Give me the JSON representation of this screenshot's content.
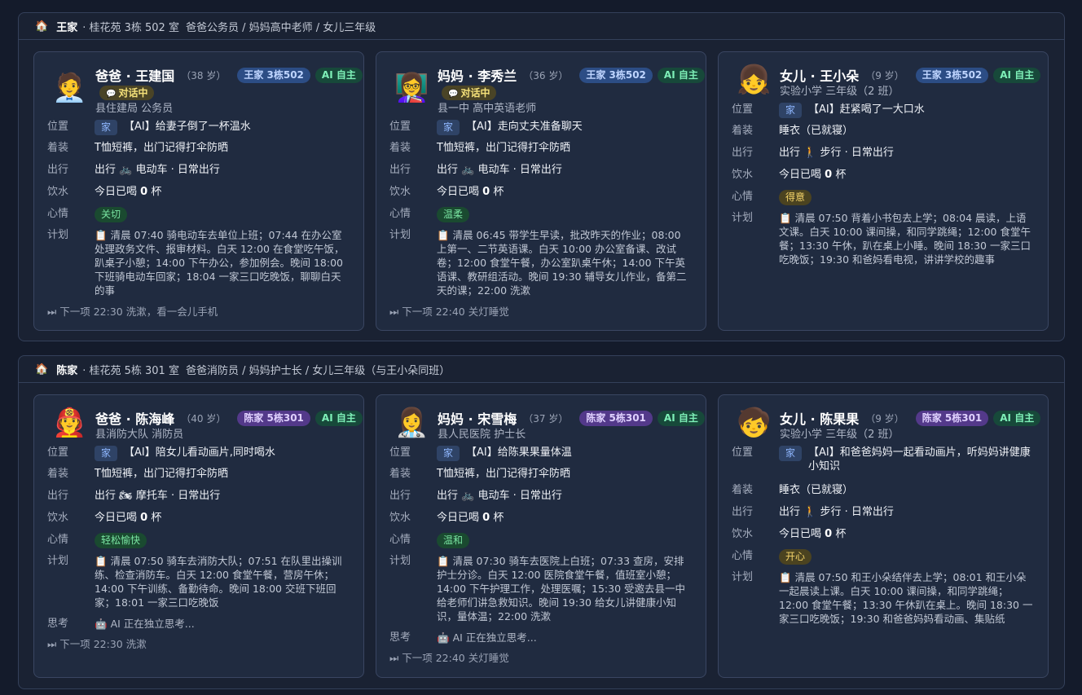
{
  "labels": {
    "location": "位置",
    "outfit": "着装",
    "travel": "出行",
    "water": "饮水",
    "mood": "心情",
    "plan": "计划",
    "thinking": "思考",
    "talking": "对话中",
    "ai_badge": "AI 自主"
  },
  "families": [
    {
      "name": "王家",
      "address": "· 桂花苑 3栋 502 室",
      "members_desc": "爸爸公务员 / 妈妈高中老师 / 女儿三年级",
      "badge": "王家 3栋502",
      "people": [
        {
          "name": "爸爸 · 王建国",
          "age": "（38 岁）",
          "talking": true,
          "role": "县住建局 公务员",
          "location_tag": "家",
          "location_text": "【AI】给妻子倒了一杯温水",
          "outfit": "T恤短裤，出门记得打伞防晒",
          "travel_prefix": "出行",
          "travel_icon": "bicycle-icon",
          "travel": "电动车 · 日常出行",
          "water_prefix": "今日已喝",
          "water_count": "0",
          "water_unit": "杯",
          "mood": "关切",
          "plan": "清晨 07:40 骑电动车去单位上班；07:44 在办公室处理政务文件、报审材料。白天 12:00 在食堂吃午饭，趴桌子小憩；14:00 下午办公，参加例会。晚间 18:00 下班骑电动车回家；18:04 一家三口吃晚饭，聊聊白天的事",
          "thinking": "",
          "next": "下一项 22:30 洗漱，看一会儿手机"
        },
        {
          "name": "妈妈 · 李秀兰",
          "age": "（36 岁）",
          "talking": true,
          "role": "县一中 高中英语老师",
          "location_tag": "家",
          "location_text": "【AI】走向丈夫准备聊天",
          "outfit": "T恤短裤，出门记得打伞防晒",
          "travel_prefix": "出行",
          "travel_icon": "bicycle-icon",
          "travel": "电动车 · 日常出行",
          "water_prefix": "今日已喝",
          "water_count": "0",
          "water_unit": "杯",
          "mood": "温柔",
          "plan": "清晨 06:45 带学生早读，批改昨天的作业；08:00 上第一、二节英语课。白天 10:00 办公室备课、改试卷；12:00 食堂午餐，办公室趴桌午休；14:00 下午英语课、教研组活动。晚间 19:30 辅导女儿作业，备第二天的课；22:00 洗漱",
          "thinking": "",
          "next": "下一项 22:40 关灯睡觉"
        },
        {
          "name": "女儿 · 王小朵",
          "age": "（9 岁）",
          "talking": false,
          "role": "实验小学 三年级（2 班）",
          "location_tag": "家",
          "location_text": "【AI】赶紧喝了一大口水",
          "outfit": "睡衣（已就寝）",
          "travel_prefix": "出行",
          "travel_icon": "walking-icon",
          "travel": "步行 · 日常出行",
          "water_prefix": "今日已喝",
          "water_count": "0",
          "water_unit": "杯",
          "mood": "得意",
          "plan": "清晨 07:50 背着小书包去上学；08:04 晨读，上语文课。白天 10:00 课间操，和同学跳绳；12:00 食堂午餐；13:30 午休，趴在桌上小睡。晚间 18:30 一家三口吃晚饭；19:30 和爸妈看电视，讲讲学校的趣事",
          "thinking": "",
          "next": ""
        }
      ]
    },
    {
      "name": "陈家",
      "address": "· 桂花苑 5栋 301 室",
      "members_desc": "爸爸消防员 / 妈妈护士长 / 女儿三年级（与王小朵同班）",
      "badge": "陈家 5栋301",
      "people": [
        {
          "name": "爸爸 · 陈海峰",
          "age": "（40 岁）",
          "talking": false,
          "role": "县消防大队 消防员",
          "location_tag": "家",
          "location_text": "【AI】陪女儿看动画片,同时喝水",
          "outfit": "T恤短裤，出门记得打伞防晒",
          "travel_prefix": "出行",
          "travel_icon": "motorcycle-icon",
          "travel": "摩托车 · 日常出行",
          "water_prefix": "今日已喝",
          "water_count": "0",
          "water_unit": "杯",
          "mood": "轻松愉快",
          "plan": "清晨 07:50 骑车去消防大队；07:51 在队里出操训练、检查消防车。白天 12:00 食堂午餐，营房午休；14:00 下午训练、备勤待命。晚间 18:00 交班下班回家；18:01 一家三口吃晚饭",
          "thinking": "AI 正在独立思考...",
          "next": "下一项 22:30 洗漱"
        },
        {
          "name": "妈妈 · 宋雪梅",
          "age": "（37 岁）",
          "talking": false,
          "role": "县人民医院 护士长",
          "location_tag": "家",
          "location_text": "【AI】给陈果果量体温",
          "outfit": "T恤短裤，出门记得打伞防晒",
          "travel_prefix": "出行",
          "travel_icon": "bicycle-icon",
          "travel": "电动车 · 日常出行",
          "water_prefix": "今日已喝",
          "water_count": "0",
          "water_unit": "杯",
          "mood": "温和",
          "plan": "清晨 07:30 骑车去医院上白班；07:33 查房，安排护士分诊。白天 12:00 医院食堂午餐，值班室小憩；14:00 下午护理工作，处理医嘱；15:30 受邀去县一中给老师们讲急救知识。晚间 19:30 给女儿讲健康小知识，量体温；22:00 洗漱",
          "thinking": "AI 正在独立思考...",
          "next": "下一项 22:40 关灯睡觉"
        },
        {
          "name": "女儿 · 陈果果",
          "age": "（9 岁）",
          "talking": false,
          "role": "实验小学 三年级（2 班）",
          "location_tag": "家",
          "location_text": "【AI】和爸爸妈妈一起看动画片，听妈妈讲健康小知识",
          "outfit": "睡衣（已就寝）",
          "travel_prefix": "出行",
          "travel_icon": "walking-icon",
          "travel": "步行 · 日常出行",
          "water_prefix": "今日已喝",
          "water_count": "0",
          "water_unit": "杯",
          "mood": "开心",
          "plan": "清晨 07:50 和王小朵结伴去上学；08:01 和王小朵一起晨读上课。白天 10:00 课间操，和同学跳绳；12:00 食堂午餐；13:30 午休趴在桌上。晚间 18:30 一家三口吃晚饭；19:30 和爸爸妈妈看动画、集贴纸",
          "thinking": "",
          "next": ""
        }
      ]
    }
  ]
}
